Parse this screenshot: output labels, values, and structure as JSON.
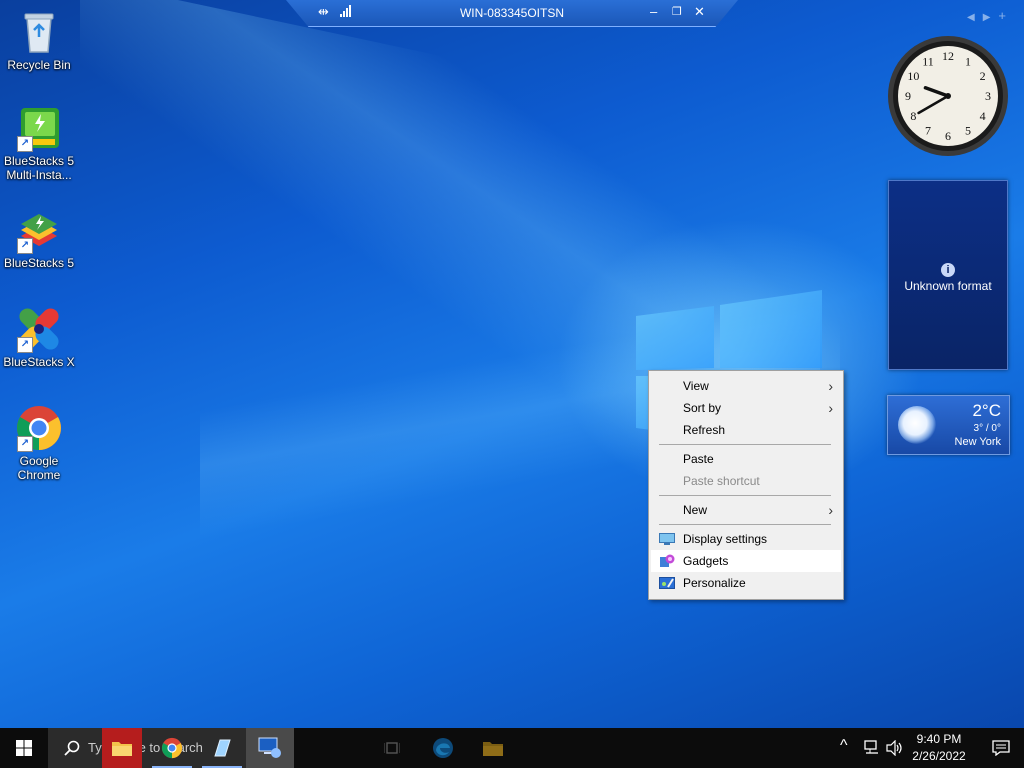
{
  "remote_bar": {
    "title": "WIN-083345OITSN"
  },
  "desktop_icons": [
    {
      "label": "Recycle Bin",
      "icon": "recycle-bin-icon"
    },
    {
      "label": "BlueStacks 5 Multi-Insta...",
      "icon": "bluestacks-multi-instance-icon"
    },
    {
      "label": "BlueStacks 5",
      "icon": "bluestacks-icon"
    },
    {
      "label": "BlueStacks X",
      "icon": "bluestacks-x-icon"
    },
    {
      "label": "Google Chrome",
      "icon": "chrome-icon"
    }
  ],
  "clock": {
    "numbers": [
      "12",
      "1",
      "2",
      "3",
      "4",
      "5",
      "6",
      "7",
      "8",
      "9",
      "10",
      "11"
    ],
    "hour": 9,
    "minute": 40
  },
  "slideshow": {
    "message": "Unknown format"
  },
  "weather": {
    "temp": "2°C",
    "range": "3° / 0°",
    "city": "New York"
  },
  "context_menu": {
    "items": [
      {
        "label": "View",
        "submenu": true
      },
      {
        "label": "Sort by",
        "submenu": true
      },
      {
        "label": "Refresh"
      },
      {
        "label": "Paste"
      },
      {
        "label": "Paste shortcut",
        "disabled": true
      },
      {
        "label": "New",
        "submenu": true
      },
      {
        "label": "Display settings",
        "icon": "display-settings-icon"
      },
      {
        "label": "Gadgets",
        "icon": "gadgets-icon",
        "highlighted": true
      },
      {
        "label": "Personalize",
        "icon": "personalize-icon"
      }
    ]
  },
  "taskbar": {
    "search_placeholder": "Type here to search",
    "time": "9:40 PM",
    "date": "2/26/2022"
  }
}
